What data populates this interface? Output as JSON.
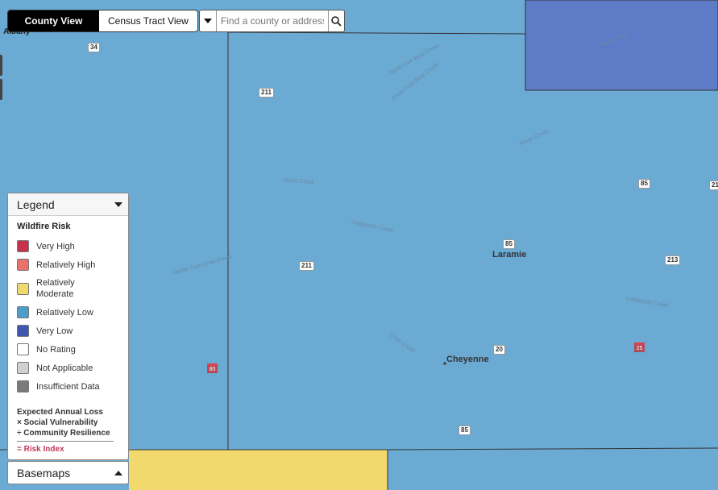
{
  "colors": {
    "relatively_low": "#6aaad3",
    "very_low": "#5a74c4",
    "relatively_moderate": "#f2d96e",
    "boundary": "#333333"
  },
  "view_toggle": {
    "county_label": "County View",
    "tract_label": "Census Tract View",
    "selected": "County View"
  },
  "search": {
    "placeholder": "Find a county or address",
    "dropdown_icon": "caret-down-icon",
    "search_icon": "magnifier-icon"
  },
  "map": {
    "places": [
      {
        "name": "Laramie",
        "kind": "city"
      },
      {
        "name": "Cheyenne",
        "kind": "city"
      },
      {
        "name": "Albany",
        "kind": "county"
      }
    ],
    "routes": [
      "34",
      "211",
      "211",
      "85",
      "85",
      "213",
      "20",
      "85",
      "21"
    ],
    "interstates": [
      "80",
      "25"
    ],
    "creeks": [
      "Bear Creek",
      "North Fork Bear Creek",
      "South Fork Bear Creek",
      "Horse Creek",
      "Horse Creek",
      "Lodgepole Creek",
      "Middle Fork Crow Creek",
      "Lodgepole Creek",
      "Crow Creek"
    ]
  },
  "legend": {
    "title": "Legend",
    "section_title": "Wildfire Risk",
    "items": [
      {
        "label": "Very High",
        "color": "#c9324e"
      },
      {
        "label": "Relatively High",
        "color": "#e8716a"
      },
      {
        "label": "Relatively Moderate",
        "color": "#f2d96e"
      },
      {
        "label": "Relatively Low",
        "color": "#4d9dc8"
      },
      {
        "label": "Very Low",
        "color": "#3e57b0"
      },
      {
        "label": "No Rating",
        "color": "#ffffff"
      },
      {
        "label": "Not Applicable",
        "color": "#d0d0d0"
      },
      {
        "label": "Insufficient Data",
        "color": "#7a7a7a"
      }
    ],
    "formula": {
      "line1": "Expected Annual Loss",
      "line2": "× Social Vulnerability",
      "line3": "÷ Community Resilience",
      "result": "= Risk Index"
    }
  },
  "basemaps": {
    "label": "Basemaps"
  }
}
